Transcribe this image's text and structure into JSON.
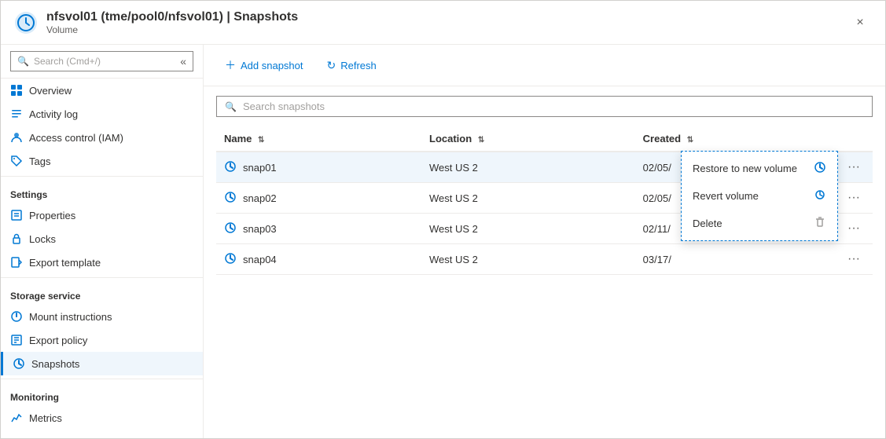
{
  "window": {
    "title": "nfsvol01 (tme/pool0/nfsvol01) | Snapshots",
    "subtitle": "Volume",
    "close_label": "×"
  },
  "sidebar": {
    "search_placeholder": "Search (Cmd+/)",
    "collapse_icon": "«",
    "items_top": [
      {
        "id": "overview",
        "label": "Overview",
        "icon": "overview"
      },
      {
        "id": "activity-log",
        "label": "Activity log",
        "icon": "activity"
      },
      {
        "id": "access-control",
        "label": "Access control (IAM)",
        "icon": "iam"
      },
      {
        "id": "tags",
        "label": "Tags",
        "icon": "tags"
      }
    ],
    "section_settings": "Settings",
    "items_settings": [
      {
        "id": "properties",
        "label": "Properties",
        "icon": "properties"
      },
      {
        "id": "locks",
        "label": "Locks",
        "icon": "locks"
      },
      {
        "id": "export-template",
        "label": "Export template",
        "icon": "export-template"
      }
    ],
    "section_storage": "Storage service",
    "items_storage": [
      {
        "id": "mount-instructions",
        "label": "Mount instructions",
        "icon": "mount"
      },
      {
        "id": "export-policy",
        "label": "Export policy",
        "icon": "export-policy"
      },
      {
        "id": "snapshots",
        "label": "Snapshots",
        "icon": "snapshots",
        "active": true
      }
    ],
    "section_monitoring": "Monitoring",
    "items_monitoring": [
      {
        "id": "metrics",
        "label": "Metrics",
        "icon": "metrics"
      }
    ]
  },
  "toolbar": {
    "add_snapshot_label": "Add snapshot",
    "refresh_label": "Refresh"
  },
  "table": {
    "search_placeholder": "Search snapshots",
    "columns": [
      "Name",
      "Location",
      "Created"
    ],
    "rows": [
      {
        "name": "snap01",
        "location": "West US 2",
        "created": "02/05/",
        "selected": true
      },
      {
        "name": "snap02",
        "location": "West US 2",
        "created": "02/05/",
        "selected": false
      },
      {
        "name": "snap03",
        "location": "West US 2",
        "created": "02/11/",
        "selected": false
      },
      {
        "name": "snap04",
        "location": "West US 2",
        "created": "03/17/",
        "selected": false
      }
    ]
  },
  "context_menu": {
    "items": [
      {
        "id": "restore",
        "label": "Restore to new volume",
        "icon": "restore"
      },
      {
        "id": "revert",
        "label": "Revert volume",
        "icon": "revert"
      },
      {
        "id": "delete",
        "label": "Delete",
        "icon": "delete"
      }
    ]
  }
}
